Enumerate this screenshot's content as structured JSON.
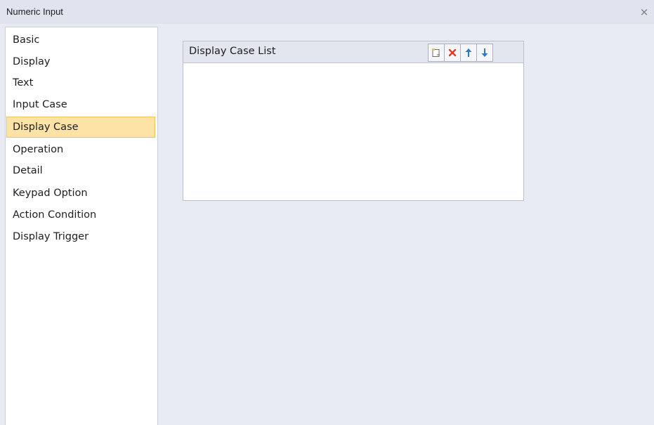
{
  "window": {
    "title": "Numeric Input",
    "close_symbol": "×"
  },
  "sidebar": {
    "items": [
      {
        "label": "Basic",
        "selected": false
      },
      {
        "label": "Display",
        "selected": false
      },
      {
        "label": "Text",
        "selected": false
      },
      {
        "label": "Input Case",
        "selected": false
      },
      {
        "label": "Display Case",
        "selected": true
      },
      {
        "label": "Operation",
        "selected": false
      },
      {
        "label": "Detail",
        "selected": false
      },
      {
        "label": "Keypad Option",
        "selected": false
      },
      {
        "label": "Action Condition",
        "selected": false
      },
      {
        "label": "Display Trigger",
        "selected": false
      }
    ]
  },
  "display_case_list": {
    "title": "Display Case List",
    "toolbar": [
      {
        "icon": "new-item-icon"
      },
      {
        "icon": "delete-icon"
      },
      {
        "icon": "arrow-up-icon"
      },
      {
        "icon": "arrow-down-icon"
      }
    ],
    "rows": []
  },
  "colors": {
    "selected_background": "#fde4a6",
    "selected_border": "#f1c15e",
    "delete_icon": "#e03b1e",
    "arrow_icon": "#2f78c9",
    "new_icon": "#f0c24a"
  }
}
